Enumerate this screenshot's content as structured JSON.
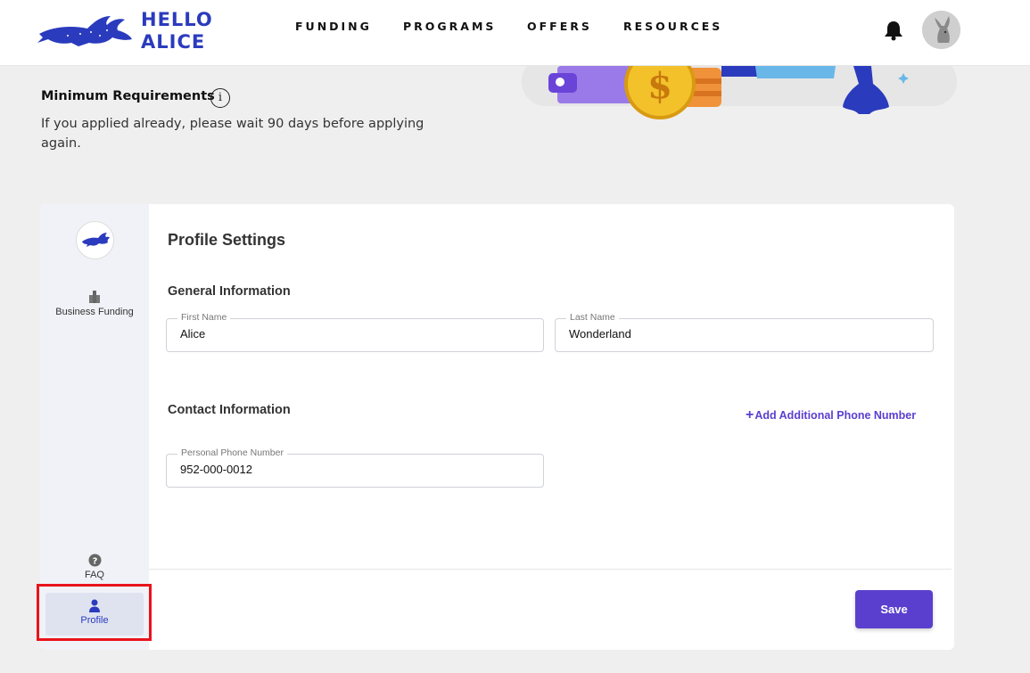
{
  "header": {
    "logo_line1": "HELLO",
    "logo_line2": "ALICE",
    "nav": [
      "FUNDING",
      "PROGRAMS",
      "OFFERS",
      "RESOURCES"
    ]
  },
  "banner": {
    "title": "Minimum Requirements",
    "info_symbol": "i",
    "text": "If you applied already, please wait 90 days before applying again."
  },
  "sidebar": {
    "items": [
      {
        "label": "Business Funding",
        "icon": "building-icon"
      },
      {
        "label": "FAQ",
        "icon": "question-icon"
      },
      {
        "label": "Profile",
        "icon": "person-icon"
      }
    ]
  },
  "profile": {
    "title": "Profile Settings",
    "general_title": "General Information",
    "first_name_label": "First Name",
    "first_name_value": "Alice",
    "last_name_label": "Last Name",
    "last_name_value": "Wonderland",
    "contact_title": "Contact Information",
    "add_phone_label": "Add Additional Phone Number",
    "phone_label": "Personal Phone Number",
    "phone_value": "952-000-0012",
    "save_label": "Save"
  },
  "colors": {
    "brand_blue": "#2b3bbd",
    "accent_purple": "#5a3fcf",
    "highlight_red": "#e8131b"
  }
}
